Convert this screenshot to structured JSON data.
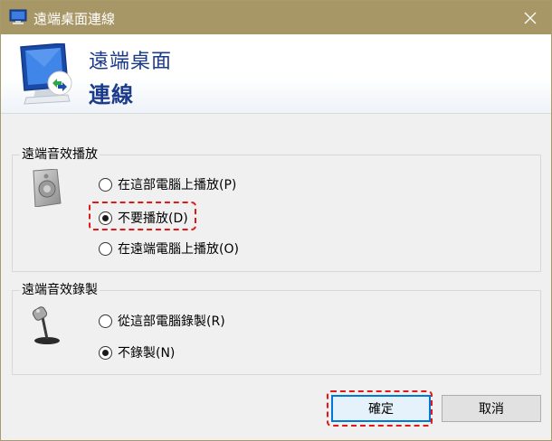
{
  "window": {
    "title": "遠端桌面連線"
  },
  "banner": {
    "line1": "遠端桌面",
    "line2": "連線"
  },
  "playback": {
    "legend": "遠端音效播放",
    "options": [
      {
        "label": "在這部電腦上播放(P)",
        "checked": false
      },
      {
        "label": "不要播放(D)",
        "checked": true
      },
      {
        "label": "在遠端電腦上播放(O)",
        "checked": false
      }
    ]
  },
  "recording": {
    "legend": "遠端音效錄製",
    "options": [
      {
        "label": "從這部電腦錄製(R)",
        "checked": false
      },
      {
        "label": "不錄製(N)",
        "checked": true
      }
    ]
  },
  "buttons": {
    "ok": "確定",
    "cancel": "取消"
  },
  "colors": {
    "titlebar": "#a89766",
    "banner_text": "#1c3a8a",
    "highlight": "#e01818",
    "default_button_border": "#0078d7"
  }
}
